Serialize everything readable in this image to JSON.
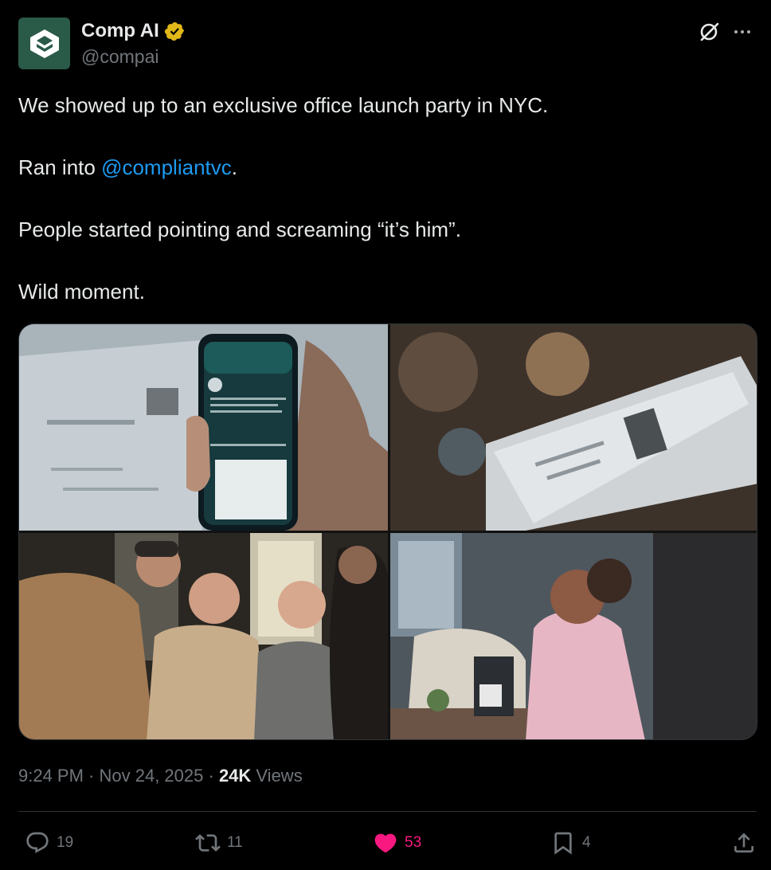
{
  "author": {
    "display_name": "Comp AI",
    "handle": "@compai",
    "avatar_color": "#2a5a48",
    "verified_color": "#e2b719"
  },
  "tweet": {
    "line1": "We showed up to an exclusive office launch party in NYC.",
    "line2_prefix": "Ran into ",
    "line2_mention": "@compliantvc",
    "line2_suffix": ".",
    "line3": "People started pointing and screaming “it’s him”.",
    "line4": "Wild moment."
  },
  "media": [
    {
      "icon": "photo-phone-screen"
    },
    {
      "icon": "photo-cocktail-menu"
    },
    {
      "icon": "photo-people-laughing"
    },
    {
      "icon": "photo-woman-at-table"
    }
  ],
  "meta": {
    "time": "9:24 PM",
    "sep1": " · ",
    "date": "Nov 24, 2025",
    "sep2": " · ",
    "views_count": "24K",
    "views_label": " Views"
  },
  "actions": {
    "replies": "19",
    "retweets": "11",
    "likes": "53",
    "bookmarks": "4"
  },
  "colors": {
    "background": "#000000",
    "text": "#e7e9ea",
    "muted": "#71767b",
    "link": "#1d9bf0",
    "like": "#f91880"
  }
}
